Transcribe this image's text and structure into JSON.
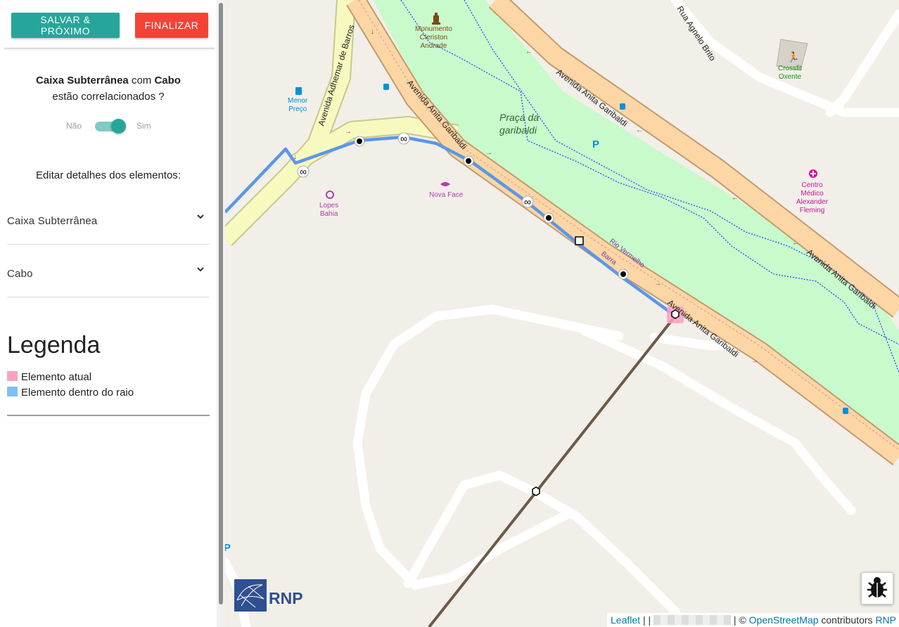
{
  "toolbar": {
    "save_label": "SALVAR & PRÓXIMO",
    "finish_label": "FINALIZAR"
  },
  "correlation": {
    "element_a": "Caixa Subterrânea",
    "connector": "com",
    "element_b": "Cabo",
    "question": "estão correlacionados ?"
  },
  "switch": {
    "off_label": "Não",
    "on_label": "Sim",
    "checked": true
  },
  "edit": {
    "title": "Editar detalhes dos elementos:"
  },
  "accordion": [
    {
      "label": "Caixa Subterrânea"
    },
    {
      "label": "Cabo"
    }
  ],
  "legend": {
    "title": "Legenda",
    "items": [
      {
        "label": "Elemento atual",
        "color": "#ff9fc4"
      },
      {
        "label": "Elemento dentro do raio",
        "color": "#7ec0f5"
      }
    ]
  },
  "map": {
    "street_labels": [
      "Avenida Anita Garibaldi",
      "Avenida Anita Garibaldi",
      "Avenida Anita Garibaldi",
      "Avenida Anita Garibaldi",
      "Avenida Adhemar de Barros",
      "Rua Agnelo Brito",
      "Rio Vermelho",
      "Barra"
    ],
    "poi_labels": {
      "monument": "Monumento\nCleriston\nAndrade",
      "park": "Praça da\ngaribaldi",
      "fuel": "Menor\nPreço",
      "lopes": "Lopes\nBahia",
      "novaface": "Nova Face",
      "crossfit": "Crossfit\nOxente",
      "medical": "Centro\nMédico\nAlexander\nFleming",
      "parking": "P"
    },
    "colors": {
      "primary_road": "#fcd6a4",
      "secondary_road": "#f7fabf",
      "park": "#c8facc",
      "route": "#5a97ea",
      "cable": "#6b5a48",
      "poi_purple": "#b03fa9",
      "poi_brown": "#7a4a14"
    },
    "logo_text": "RNP"
  },
  "attribution": {
    "leaflet": "Leaflet",
    "separator": "| |",
    "copyright": "©",
    "osm": "OpenStreetMap",
    "contributors": "contributors",
    "rnp": "RNP"
  }
}
